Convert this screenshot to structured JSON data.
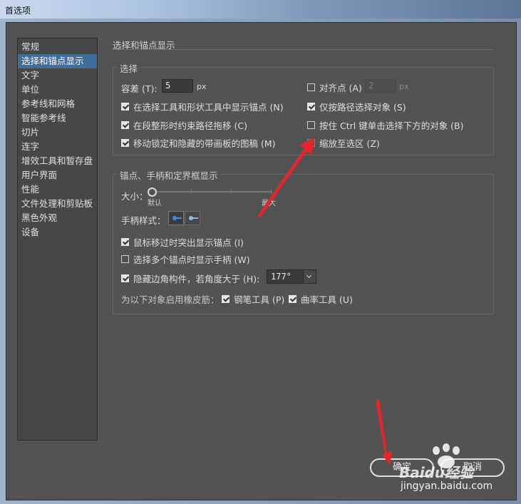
{
  "window": {
    "title": "首选项"
  },
  "sidebar": {
    "items": [
      {
        "label": "常规"
      },
      {
        "label": "选择和锚点显示",
        "selected": true
      },
      {
        "label": "文字"
      },
      {
        "label": "单位"
      },
      {
        "label": "参考线和网格"
      },
      {
        "label": "智能参考线"
      },
      {
        "label": "切片"
      },
      {
        "label": "连字"
      },
      {
        "label": "增效工具和暂存盘"
      },
      {
        "label": "用户界面"
      },
      {
        "label": "性能"
      },
      {
        "label": "文件处理和剪贴板"
      },
      {
        "label": "黑色外观"
      },
      {
        "label": "设备"
      }
    ]
  },
  "main": {
    "section_title": "选择和锚点显示",
    "selection": {
      "title": "选择",
      "tolerance_label": "容差 (T):",
      "tolerance_value": "5",
      "tolerance_unit": "px",
      "snap_label": "对齐点 (A)",
      "snap_value": "2",
      "snap_unit": "px",
      "options": [
        {
          "label": "在选择工具和形状工具中显示锚点 (N)",
          "checked": true
        },
        {
          "label": "仅按路径选择对象 (S)",
          "checked": true
        },
        {
          "label": "在段整形时约束路径拖移 (C)",
          "checked": true
        },
        {
          "label": "按住 Ctrl 键单击选择下方的对象 (B)",
          "checked": false
        },
        {
          "label": "移动锁定和隐藏的带画板的图稿 (M)",
          "checked": true
        },
        {
          "label": "缩放至选区 (Z)",
          "checked": false
        }
      ]
    },
    "anchor": {
      "title": "锚点、手柄和定界框显示",
      "size_label": "大小：",
      "size_min": "默认",
      "size_max": "最大",
      "size_level": 0,
      "handle_style_label": "手柄样式：",
      "highlight_label": "鼠标移过时突出显示锚点 (I)",
      "highlight_checked": true,
      "multi_label": "选择多个锚点时显示手柄 (W)",
      "multi_checked": false,
      "hide_corner_label": "隐藏边角构件，若角度大于 (H):",
      "hide_corner_checked": true,
      "angle_value": "177°",
      "rubber_label": "为以下对象启用橡皮筋：",
      "pen_label": "钢笔工具 (P)",
      "pen_checked": true,
      "curvature_label": "曲率工具 (U)",
      "curvature_checked": true
    }
  },
  "footer": {
    "ok_label": "确定",
    "cancel_label": "取消"
  },
  "watermark": {
    "brand": "Baidu经验",
    "url": "jingyan.baidu.com"
  },
  "colors": {
    "accent": "#3f6d9e",
    "annotation": "#e8232a"
  }
}
